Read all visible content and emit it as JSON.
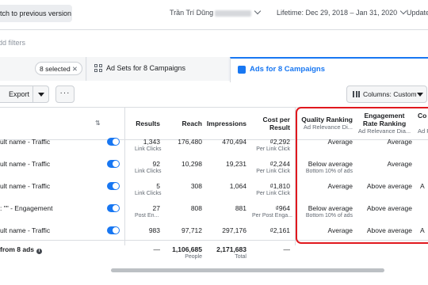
{
  "topbar": {
    "prev_button": "tch to previous version",
    "user_name": "Trần Trí Dũng",
    "lifetime": "Lifetime: Dec 29, 2018 – Jan 31, 2020",
    "update": "Update"
  },
  "filters": {
    "placeholder": "dd filters"
  },
  "tabs": {
    "selected_pill": "8 selected",
    "ad_sets": "Ad Sets for 8 Campaigns",
    "ads": "Ads for 8 Campaigns"
  },
  "toolbar": {
    "export": "Export",
    "more": "···",
    "columns": "Columns: Custom"
  },
  "headers": {
    "results": "Results",
    "reach": "Reach",
    "impressions": "Impressions",
    "cost_per_result_1": "Cost per",
    "cost_per_result_2": "Result",
    "quality_ranking": "Quality Ranking",
    "quality_ranking_sub": "Ad Relevance Di...",
    "engagement_1": "Engagement",
    "engagement_2": "Rate Ranking",
    "engagement_sub": "Ad Relevance Dia...",
    "conv_1": "Co",
    "conv_sub": "Ad R"
  },
  "rows": [
    {
      "name": "ult name - Traffic",
      "results": "1,343",
      "results_sub": "Link Clicks",
      "reach": "176,480",
      "impressions": "470,494",
      "cost": "₫2,292",
      "cost_sub": "Per Link Click",
      "quality": "Average",
      "quality_sub": "",
      "engagement": "Average",
      "conv": ""
    },
    {
      "name": "ult name - Traffic",
      "results": "92",
      "results_sub": "Link Clicks",
      "reach": "10,298",
      "impressions": "19,231",
      "cost": "₫2,244",
      "cost_sub": "Per Link Click",
      "quality": "Below average",
      "quality_sub": "Bottom 10% of ads",
      "engagement": "Average",
      "conv": ""
    },
    {
      "name": "ult name - Traffic",
      "results": "5",
      "results_sub": "Link Clicks",
      "reach": "308",
      "impressions": "1,064",
      "cost": "₫1,810",
      "cost_sub": "Per Link Click",
      "quality": "Average",
      "quality_sub": "",
      "engagement": "Above average",
      "conv": "A"
    },
    {
      "name": ": \"\" - Engagement",
      "results": "27",
      "results_sub": "Post En...",
      "reach": "808",
      "impressions": "881",
      "cost": "₫964",
      "cost_sub": "Per Post Enga...",
      "quality": "Below average",
      "quality_sub": "Bottom 10% of ads",
      "engagement": "Above average",
      "conv": ""
    },
    {
      "name": "ult name - Traffic",
      "results": "983",
      "results_sub": "",
      "reach": "97,712",
      "impressions": "297,176",
      "cost": "₫2,161",
      "cost_sub": "",
      "quality": "Average",
      "quality_sub": "",
      "engagement": "Above average",
      "conv": "A"
    }
  ],
  "totals": {
    "label": "from 8 ads",
    "results": "—",
    "reach": "1,106,685",
    "reach_sub": "People",
    "impressions": "2,171,683",
    "impressions_sub": "Total",
    "cost": "—"
  },
  "colors": {
    "accent": "#1877f2",
    "highlight": "#e0181e"
  }
}
